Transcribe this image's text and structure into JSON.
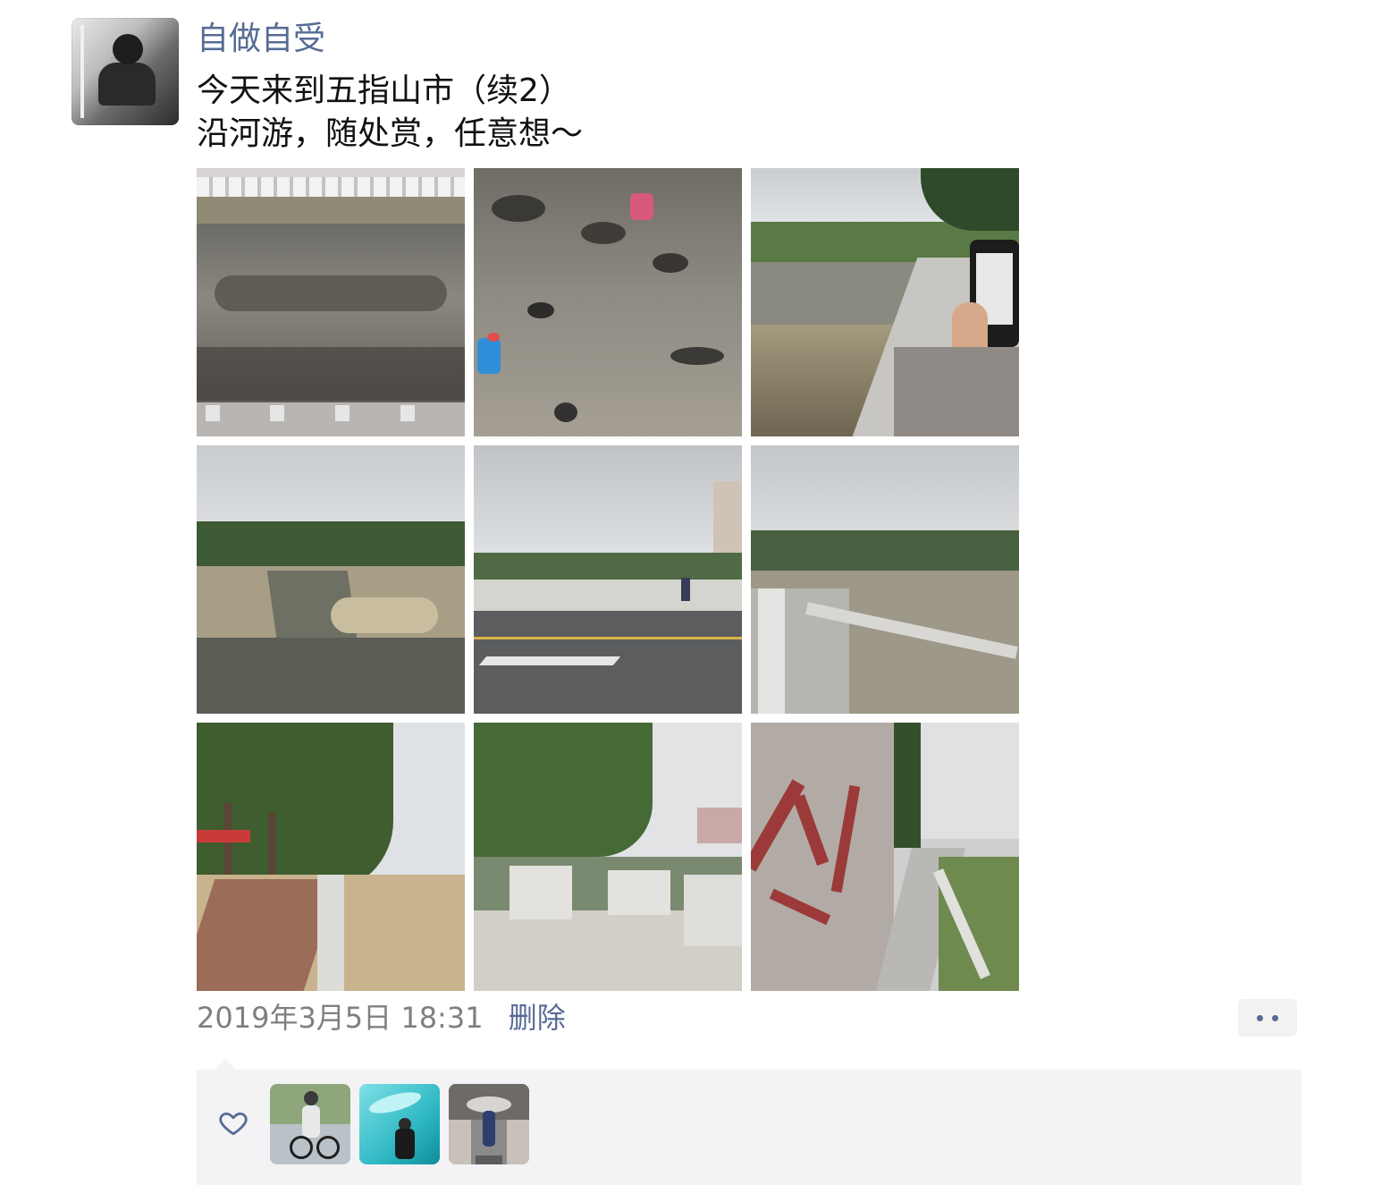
{
  "post": {
    "author": "自做自受",
    "text": "今天来到五指山市（续2）\n沿河游，随处赏，任意想～",
    "photos": [
      {
        "id": 1,
        "subject": "river-rocks-wide"
      },
      {
        "id": 2,
        "subject": "people-in-shallow-river"
      },
      {
        "id": 3,
        "subject": "riverbank-with-phone"
      },
      {
        "id": 4,
        "subject": "river-channel-view"
      },
      {
        "id": 5,
        "subject": "road-and-bridge"
      },
      {
        "id": 6,
        "subject": "stone-railing-river"
      },
      {
        "id": 7,
        "subject": "tree-lined-path"
      },
      {
        "id": 8,
        "subject": "stairs-to-river"
      },
      {
        "id": 9,
        "subject": "red-calligraphy-wall"
      }
    ],
    "timestamp": "2019年3月5日 18:31",
    "delete_label": "删除",
    "more_icon": "more-dots-icon",
    "likes": {
      "icon": "heart-outline-icon",
      "likers": [
        {
          "avatar": "cyclist-avatar"
        },
        {
          "avatar": "teal-artwork-avatar"
        },
        {
          "avatar": "street-pose-avatar"
        }
      ]
    },
    "colors": {
      "link": "#576b95",
      "time": "#7f7f7f",
      "like_panel": "#f3f3f5"
    }
  }
}
